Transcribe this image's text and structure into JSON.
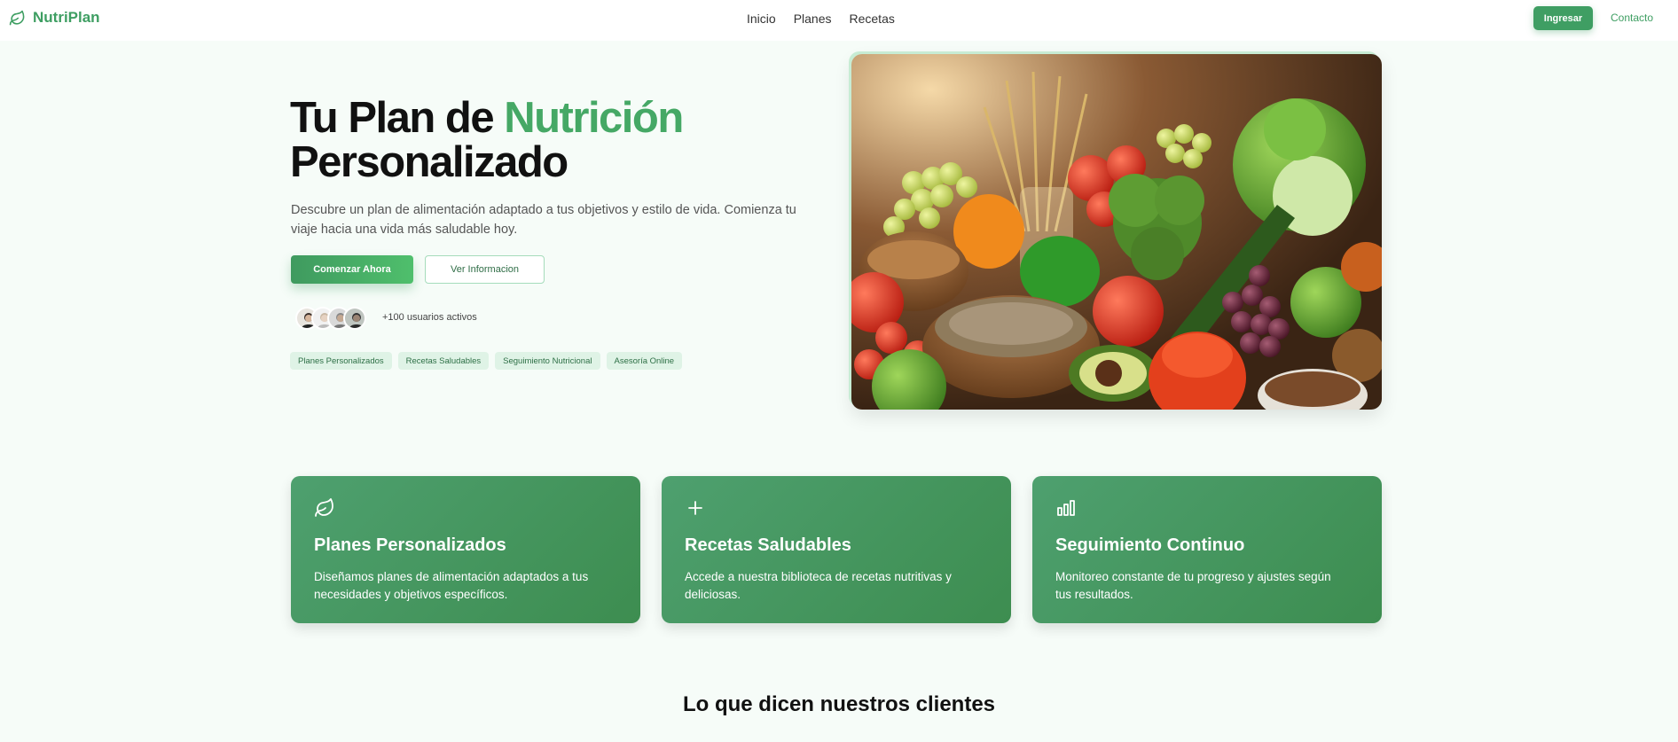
{
  "brand": {
    "name": "NutriPlan",
    "icon": "leaf-icon",
    "color": "#3e9e62"
  },
  "nav": {
    "links": [
      "Inicio",
      "Planes",
      "Recetas"
    ],
    "login_label": "Ingresar",
    "contact_label": "Contacto"
  },
  "hero": {
    "title_part1": "Tu Plan de ",
    "title_accent": "Nutrición",
    "title_part2": "Personalizado",
    "description": "Descubre un plan de alimentación adaptado a tus objetivos y estilo de vida. Comienza tu viaje hacia una vida más saludable hoy.",
    "primary_button": "Comenzar Ahora",
    "secondary_button": "Ver Informacion",
    "users_text": "+100 usuarios activos",
    "tags": [
      "Planes Personalizados",
      "Recetas Saludables",
      "Seguimiento Nutricional",
      "Asesoría Online"
    ],
    "accent_color": "#45a865"
  },
  "features": [
    {
      "icon": "leaf-icon",
      "title": "Planes Personalizados",
      "text": "Diseñamos planes de alimentación adaptados a tus necesidades y objetivos específicos."
    },
    {
      "icon": "plus-icon",
      "title": "Recetas Saludables",
      "text": "Accede a nuestra biblioteca de recetas nutritivas y deliciosas."
    },
    {
      "icon": "bar-chart-icon",
      "title": "Seguimiento Continuo",
      "text": "Monitoreo constante de tu progreso y ajustes según tus resultados."
    }
  ],
  "testimonials": {
    "title": "Lo que dicen nuestros clientes"
  }
}
